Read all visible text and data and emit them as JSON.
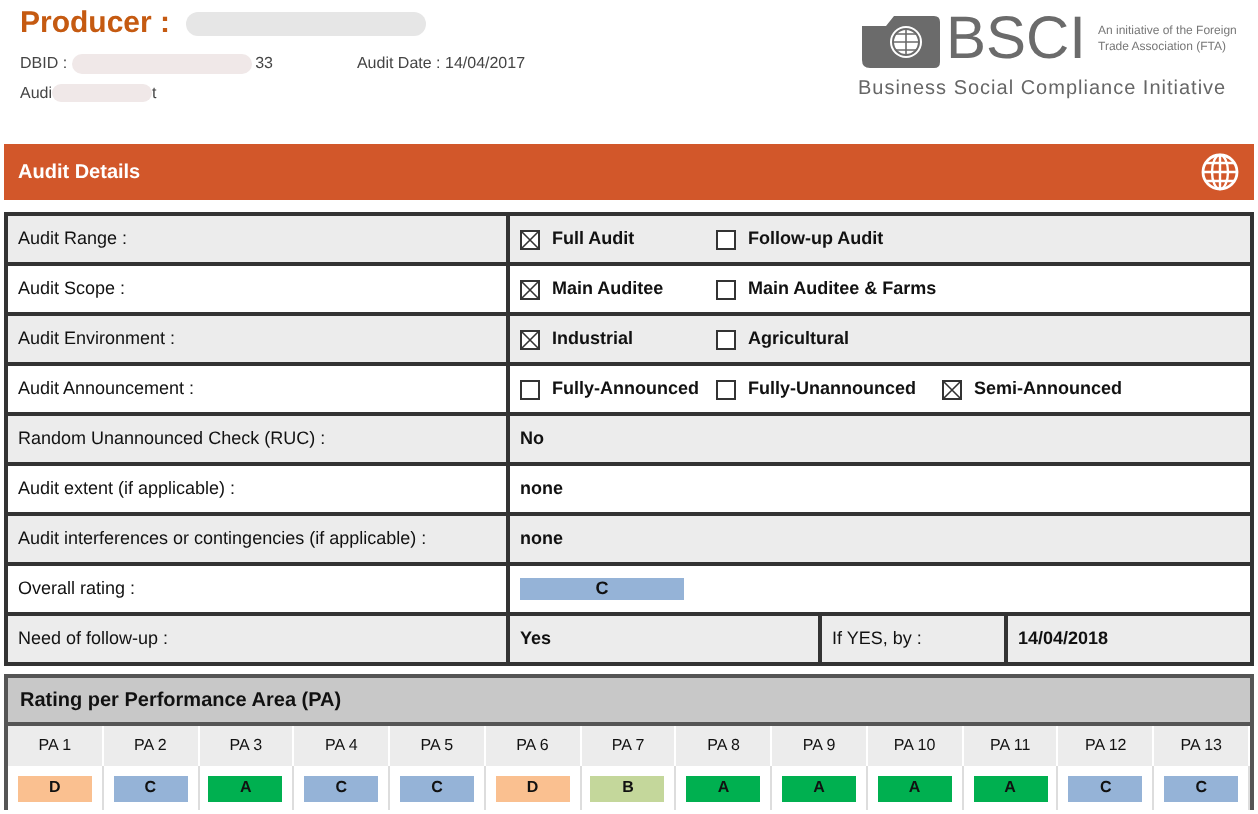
{
  "header": {
    "title": "Producer :",
    "dbid_label": "DBID :",
    "dbid_tail": "33",
    "audit_date": "Audit Date : 14/04/2017",
    "auditor_head": "Audi",
    "auditor_tail": "t"
  },
  "logo": {
    "mark": "BSCI",
    "tagline": "An initiative of the Foreign Trade Association (FTA)",
    "name": "Business Social Compliance Initiative"
  },
  "section": {
    "title": "Audit Details"
  },
  "rows": [
    {
      "kind": "options",
      "label": "Audit Range :",
      "options": [
        {
          "label": "Full Audit",
          "checked": true
        },
        {
          "label": "Follow-up Audit",
          "checked": false
        }
      ]
    },
    {
      "kind": "options",
      "label": "Audit Scope :",
      "options": [
        {
          "label": "Main Auditee",
          "checked": true
        },
        {
          "label": "Main Auditee & Farms",
          "checked": false
        }
      ]
    },
    {
      "kind": "options",
      "label": "Audit Environment :",
      "options": [
        {
          "label": "Industrial",
          "checked": true
        },
        {
          "label": "Agricultural",
          "checked": false
        }
      ]
    },
    {
      "kind": "options",
      "label": "Audit Announcement :",
      "options": [
        {
          "label": "Fully-Announced",
          "checked": false
        },
        {
          "label": "Fully-Unannounced",
          "checked": false
        },
        {
          "label": "Semi-Announced",
          "checked": true
        }
      ]
    },
    {
      "kind": "text",
      "label": "Random Unannounced Check (RUC) :",
      "value": "No"
    },
    {
      "kind": "text",
      "label": "Audit extent (if applicable) :",
      "value": "none"
    },
    {
      "kind": "text",
      "label": "Audit interferences or contingencies (if applicable) :",
      "value": "none"
    },
    {
      "kind": "rating",
      "label": "Overall rating :",
      "value": "C",
      "color": "#95b3d7"
    },
    {
      "kind": "followup",
      "label": "Need of follow-up :",
      "value": "Yes",
      "by_label": "If YES, by :",
      "by_value": "14/04/2018"
    }
  ],
  "pa": {
    "title": "Rating per Performance Area (PA)",
    "areas": [
      {
        "label": "PA 1",
        "rating": "D",
        "color": "#fac090"
      },
      {
        "label": "PA 2",
        "rating": "C",
        "color": "#95b3d7"
      },
      {
        "label": "PA 3",
        "rating": "A",
        "color": "#00b050"
      },
      {
        "label": "PA 4",
        "rating": "C",
        "color": "#95b3d7"
      },
      {
        "label": "PA 5",
        "rating": "C",
        "color": "#95b3d7"
      },
      {
        "label": "PA 6",
        "rating": "D",
        "color": "#fac090"
      },
      {
        "label": "PA 7",
        "rating": "B",
        "color": "#c4d79b"
      },
      {
        "label": "PA 8",
        "rating": "A",
        "color": "#00b050"
      },
      {
        "label": "PA 9",
        "rating": "A",
        "color": "#00b050"
      },
      {
        "label": "PA 10",
        "rating": "A",
        "color": "#00b050"
      },
      {
        "label": "PA 11",
        "rating": "A",
        "color": "#00b050"
      },
      {
        "label": "PA 12",
        "rating": "C",
        "color": "#95b3d7"
      },
      {
        "label": "PA 13",
        "rating": "C",
        "color": "#95b3d7"
      }
    ]
  }
}
